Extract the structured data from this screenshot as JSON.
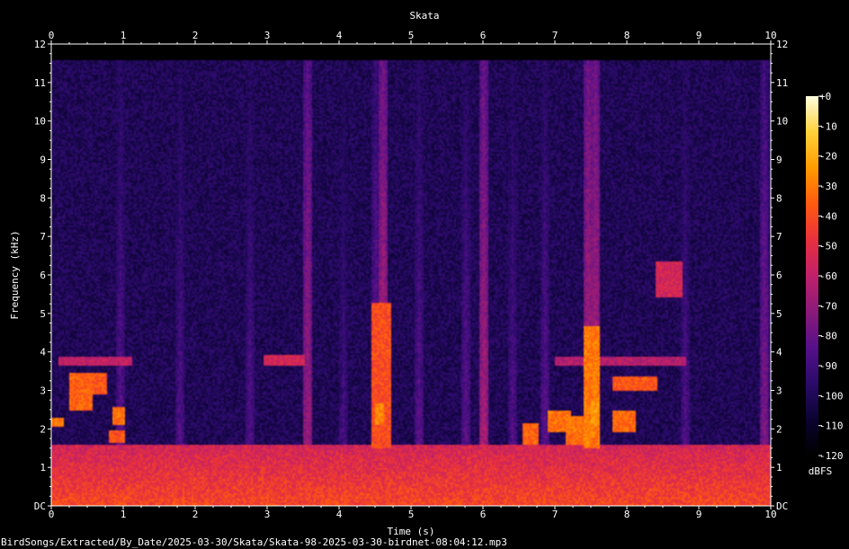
{
  "chart_data": {
    "type": "heatmap",
    "subtype": "spectrogram",
    "title": "Skata",
    "xlabel": "Time (s)",
    "ylabel": "Frequency (kHz)",
    "xlim": [
      0,
      10
    ],
    "ylim": [
      0,
      12
    ],
    "x_ticks": [
      "0",
      "1",
      "2",
      "3",
      "4",
      "5",
      "6",
      "7",
      "8",
      "9",
      "10"
    ],
    "y_ticks": [
      "DC",
      "1",
      "2",
      "3",
      "4",
      "5",
      "6",
      "7",
      "8",
      "9",
      "10",
      "11",
      "12"
    ],
    "colorbar": {
      "label": "dBFS",
      "range": [
        -120,
        0
      ],
      "ticks": [
        "+0",
        "-10",
        "-20",
        "-30",
        "-40",
        "-50",
        "-60",
        "-70",
        "-80",
        "-90",
        "-100",
        "-110",
        "-120"
      ],
      "colormap": [
        "#000000",
        "#0b0330",
        "#2a0b6a",
        "#56108a",
        "#8a1a7a",
        "#c0206a",
        "#e8303e",
        "#ff5a10",
        "#ff9a00",
        "#ffd23a",
        "#fffde0"
      ]
    },
    "background_level_db": -100,
    "frequency_cutoff_khz": 11.6,
    "low_band_level_db": -45,
    "vertical_streaks": [
      {
        "t": 0.95,
        "level_db": -80
      },
      {
        "t": 1.78,
        "level_db": -82
      },
      {
        "t": 2.75,
        "level_db": -82
      },
      {
        "t": 3.55,
        "level_db": -65
      },
      {
        "t": 4.05,
        "level_db": -85
      },
      {
        "t": 4.5,
        "level_db": -75
      },
      {
        "t": 4.6,
        "level_db": -60
      },
      {
        "t": 5.1,
        "level_db": -80
      },
      {
        "t": 5.75,
        "level_db": -80
      },
      {
        "t": 6.0,
        "level_db": -62
      },
      {
        "t": 6.4,
        "level_db": -82
      },
      {
        "t": 6.85,
        "level_db": -80
      },
      {
        "t": 7.45,
        "level_db": -60
      },
      {
        "t": 7.55,
        "level_db": -60
      },
      {
        "t": 8.8,
        "level_db": -82
      },
      {
        "t": 9.9,
        "level_db": -72
      }
    ],
    "calls": [
      {
        "t0": 0.0,
        "t1": 0.15,
        "f0": 2.15,
        "f1": 2.25,
        "level_db": -30
      },
      {
        "t0": 0.25,
        "t1": 0.55,
        "f0": 2.6,
        "f1": 3.4,
        "level_db": -35
      },
      {
        "t0": 0.5,
        "t1": 0.75,
        "f0": 3.0,
        "f1": 3.4,
        "level_db": -38
      },
      {
        "t0": 0.85,
        "t1": 1.0,
        "f0": 2.2,
        "f1": 2.5,
        "level_db": -32
      },
      {
        "t0": 0.8,
        "t1": 1.0,
        "f0": 1.75,
        "f1": 1.9,
        "level_db": -38
      },
      {
        "t0": 0.1,
        "t1": 1.1,
        "f0": 3.75,
        "f1": 3.8,
        "level_db": -60
      },
      {
        "t0": 2.95,
        "t1": 3.5,
        "f0": 3.75,
        "f1": 3.85,
        "level_db": -55
      },
      {
        "t0": 4.45,
        "t1": 4.7,
        "f0": 1.6,
        "f1": 5.2,
        "level_db": -40
      },
      {
        "t0": 4.5,
        "t1": 4.6,
        "f0": 2.2,
        "f1": 2.6,
        "level_db": -28
      },
      {
        "t0": 6.55,
        "t1": 6.75,
        "f0": 1.7,
        "f1": 2.1,
        "level_db": -35
      },
      {
        "t0": 6.9,
        "t1": 7.2,
        "f0": 2.0,
        "f1": 2.4,
        "level_db": -32
      },
      {
        "t0": 7.15,
        "t1": 7.45,
        "f0": 1.7,
        "f1": 2.3,
        "level_db": -32
      },
      {
        "t0": 7.4,
        "t1": 7.6,
        "f0": 1.6,
        "f1": 4.6,
        "level_db": -30
      },
      {
        "t0": 7.5,
        "t1": 7.6,
        "f0": 2.2,
        "f1": 2.7,
        "level_db": -25
      },
      {
        "t0": 7.8,
        "t1": 8.1,
        "f0": 2.0,
        "f1": 2.4,
        "level_db": -34
      },
      {
        "t0": 7.8,
        "t1": 8.4,
        "f0": 3.1,
        "f1": 3.3,
        "level_db": -38
      },
      {
        "t0": 7.0,
        "t1": 8.8,
        "f0": 3.75,
        "f1": 3.8,
        "level_db": -62
      },
      {
        "t0": 8.4,
        "t1": 8.75,
        "f0": 5.5,
        "f1": 6.3,
        "level_db": -55
      }
    ]
  },
  "footer": {
    "path": "BirdSongs/Extracted/By_Date/2025-03-30/Skata/Skata-98-2025-03-30-birdnet-08:04:12.mp3"
  },
  "colors": {
    "background": "#000000",
    "text": "#ffffff",
    "axis": "#ffffff"
  }
}
